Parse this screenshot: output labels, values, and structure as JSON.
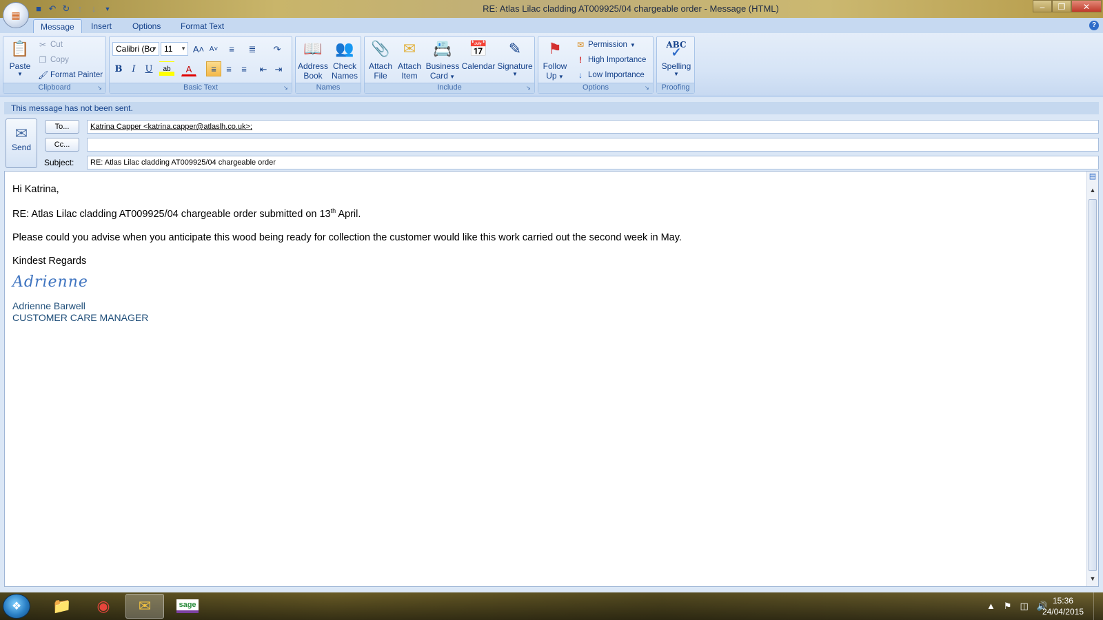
{
  "window": {
    "title": "RE: Atlas Lilac cladding  AT009925/04 chargeable order - Message (HTML)",
    "orb_label": "Office"
  },
  "tabs": [
    "Message",
    "Insert",
    "Options",
    "Format Text"
  ],
  "ribbon": {
    "clipboard": {
      "label": "Clipboard",
      "paste": "Paste",
      "cut": "Cut",
      "copy": "Copy",
      "format_painter": "Format Painter"
    },
    "basic_text": {
      "label": "Basic Text",
      "font": "Calibri (Bo",
      "size": "11",
      "bold": "B",
      "italic": "I",
      "underline": "U"
    },
    "names": {
      "label": "Names",
      "address_book": [
        "Address",
        "Book"
      ],
      "check_names": [
        "Check",
        "Names"
      ]
    },
    "include": {
      "label": "Include",
      "attach_file": [
        "Attach",
        "File"
      ],
      "attach_item": [
        "Attach",
        "Item"
      ],
      "business_card": [
        "Business",
        "Card"
      ],
      "calendar": "Calendar",
      "signature": "Signature"
    },
    "options": {
      "label": "Options",
      "follow_up": [
        "Follow",
        "Up"
      ],
      "permission": "Permission",
      "high_importance": "High Importance",
      "low_importance": "Low Importance"
    },
    "proofing": {
      "label": "Proofing",
      "abc": "ABC",
      "spelling": "Spelling"
    }
  },
  "notice": "This message has not been sent.",
  "compose": {
    "send": "Send",
    "to_button": "To...",
    "cc_button": "Cc...",
    "subject_label": "Subject:",
    "to_value": "Katrina Capper  <katrina.capper@atlaslh.co.uk>;",
    "cc_value": "",
    "subject_value": "RE: Atlas Lilac cladding  AT009925/04 chargeable order"
  },
  "body": {
    "greeting": "Hi Katrina,",
    "line1_pre": "RE: Atlas Lilac cladding  AT009925/04 chargeable order submitted on 13",
    "line1_sup": "th",
    "line1_post": " April.",
    "line2": "Please could you advise when you anticipate this wood being ready for collection the customer would like this work carried out the second week in May.",
    "closing": "Kindest Regards",
    "signature_script": "Adrienne",
    "signature_name": "Adrienne Barwell",
    "signature_title": "CUSTOMER CARE MANAGER"
  },
  "taskbar": {
    "time": "15:36",
    "date": "24/04/2015",
    "sage_label": "sage"
  }
}
